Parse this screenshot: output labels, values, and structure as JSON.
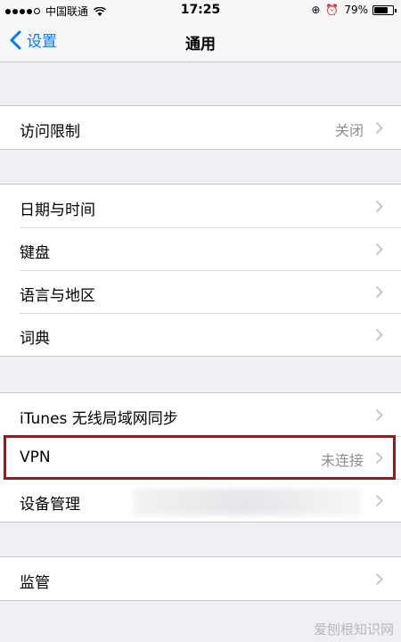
{
  "status_bar": {
    "carrier": "中国联通",
    "time": "17:25",
    "battery": "79%",
    "battery_level": 0.79
  },
  "nav": {
    "back_label": "设置",
    "title": "通用"
  },
  "groups": [
    {
      "rows": [
        {
          "label": "访问限制",
          "value": "关闭"
        }
      ]
    },
    {
      "rows": [
        {
          "label": "日期与时间"
        },
        {
          "label": "键盘"
        },
        {
          "label": "语言与地区"
        },
        {
          "label": "词典"
        }
      ]
    },
    {
      "rows": [
        {
          "label": "iTunes 无线局域网同步"
        },
        {
          "label": "VPN",
          "value": "未连接"
        },
        {
          "label": "设备管理"
        }
      ]
    },
    {
      "rows": [
        {
          "label": "监管"
        }
      ]
    }
  ],
  "watermark": "爱刨根知识网",
  "colors": {
    "accent": "#007aff",
    "highlight": "#8e1d24",
    "background": "#efeff4"
  }
}
